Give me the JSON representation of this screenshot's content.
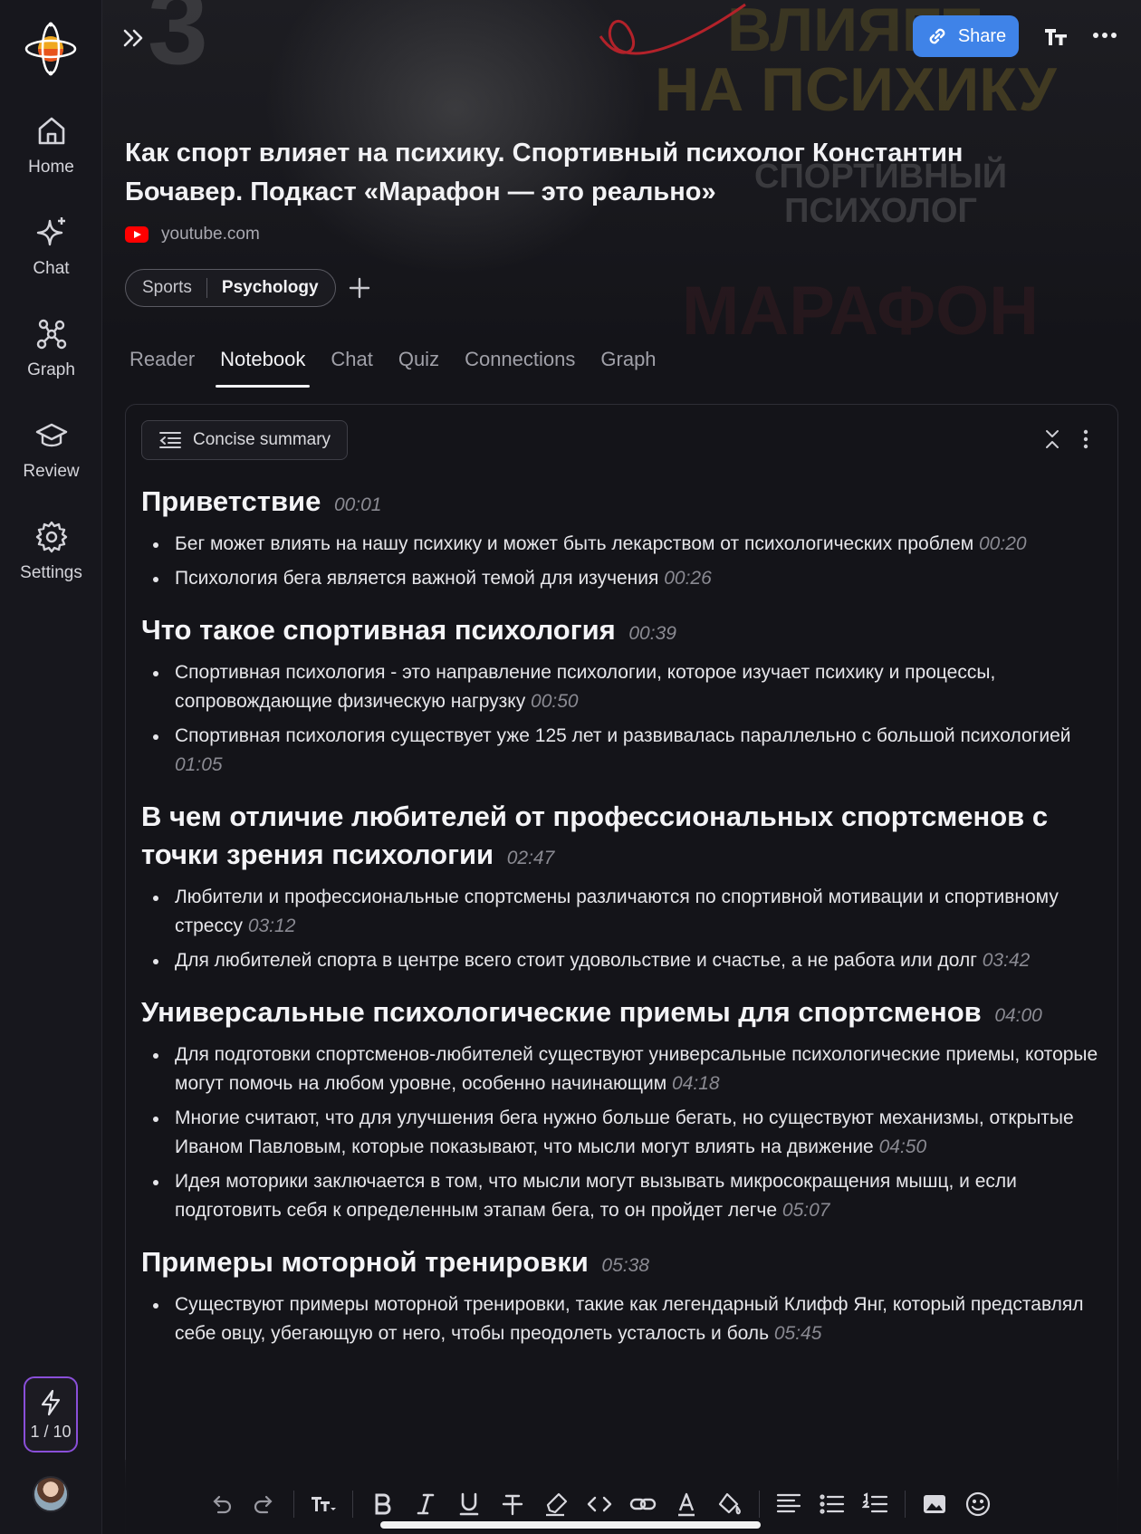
{
  "sidebar": {
    "items": [
      {
        "label": "Home"
      },
      {
        "label": "Chat"
      },
      {
        "label": "Graph"
      },
      {
        "label": "Review"
      },
      {
        "label": "Settings"
      }
    ],
    "usage": "1 / 10"
  },
  "header": {
    "banner_text": [
      "ВЛИЯЕТ",
      "НА ПСИХИКУ",
      "СПОРТИВНЫЙ\nПСИХОЛОГ",
      "МАРАФОН"
    ],
    "share_label": "Share",
    "title": "Как спорт влияет на психику. Спортивный психолог Константин Бочавер. Подкаст «Марафон — это реально»",
    "source": "youtube.com",
    "tags": [
      "Sports",
      "Psychology"
    ]
  },
  "tabs": [
    "Reader",
    "Notebook",
    "Chat",
    "Quiz",
    "Connections",
    "Graph"
  ],
  "active_tab": "Notebook",
  "notebook": {
    "summary_mode": "Concise summary",
    "sections": [
      {
        "heading": "Приветствие",
        "time": "00:01",
        "bullets": [
          {
            "text": "Бег может влиять на нашу психику и может быть лекарством от психологических проблем",
            "time": "00:20"
          },
          {
            "text": "Психология бега является важной темой для изучения",
            "time": "00:26"
          }
        ]
      },
      {
        "heading": "Что такое спортивная психология",
        "time": "00:39",
        "bullets": [
          {
            "text": "Спортивная психология - это направление психологии, которое изучает психику и процессы, сопровождающие физическую нагрузку",
            "time": "00:50"
          },
          {
            "text": "Спортивная психология существует уже 125 лет и развивалась параллельно с большой психологией",
            "time": "01:05"
          }
        ]
      },
      {
        "heading": "В чем отличие любителей от профессиональных спортсменов с точки зрения психологии",
        "time": "02:47",
        "bullets": [
          {
            "text": "Любители и профессиональные спортсмены различаются по спортивной мотивации и спортивному стрессу",
            "time": "03:12"
          },
          {
            "text": "Для любителей спорта в центре всего стоит удовольствие и счастье, а не работа или долг",
            "time": "03:42"
          }
        ]
      },
      {
        "heading": "Универсальные психологические приемы для спортсменов",
        "time": "04:00",
        "bullets": [
          {
            "text": "Для подготовки спортсменов-любителей существуют универсальные психологические приемы, которые могут помочь на любом уровне, особенно начинающим",
            "time": "04:18"
          },
          {
            "text": "Многие считают, что для улучшения бега нужно больше бегать, но существуют механизмы, открытые Иваном Павловым, которые показывают, что мысли могут влиять на движение",
            "time": "04:50"
          },
          {
            "text": "Идея моторики заключается в том, что мысли могут вызывать микросокращения мышц, и если подготовить себя к определенным этапам бега, то он пройдет легче",
            "time": "05:07"
          }
        ]
      },
      {
        "heading": "Примеры моторной тренировки",
        "time": "05:38",
        "bullets": [
          {
            "text": "Существуют примеры моторной тренировки, такие как легендарный Клифф Янг, который представлял себе овцу, убегающую от него, чтобы преодолеть усталость и боль",
            "time": "05:45"
          }
        ]
      }
    ]
  },
  "toolbar": {
    "buttons": [
      "undo-icon",
      "redo-icon",
      "text-size-icon",
      "bold-icon",
      "italic-icon",
      "underline-icon",
      "strikethrough-icon",
      "highlighter-icon",
      "code-icon",
      "link-icon",
      "text-color-icon",
      "fill-color-icon",
      "align-icon",
      "bullet-list-icon",
      "numbered-list-icon",
      "image-icon",
      "emoji-icon"
    ]
  },
  "colors": {
    "background": "#141419",
    "accent": "#3f83e8",
    "upgrade_border": "#8a4fd9",
    "timestamp": "#8a8a92"
  }
}
